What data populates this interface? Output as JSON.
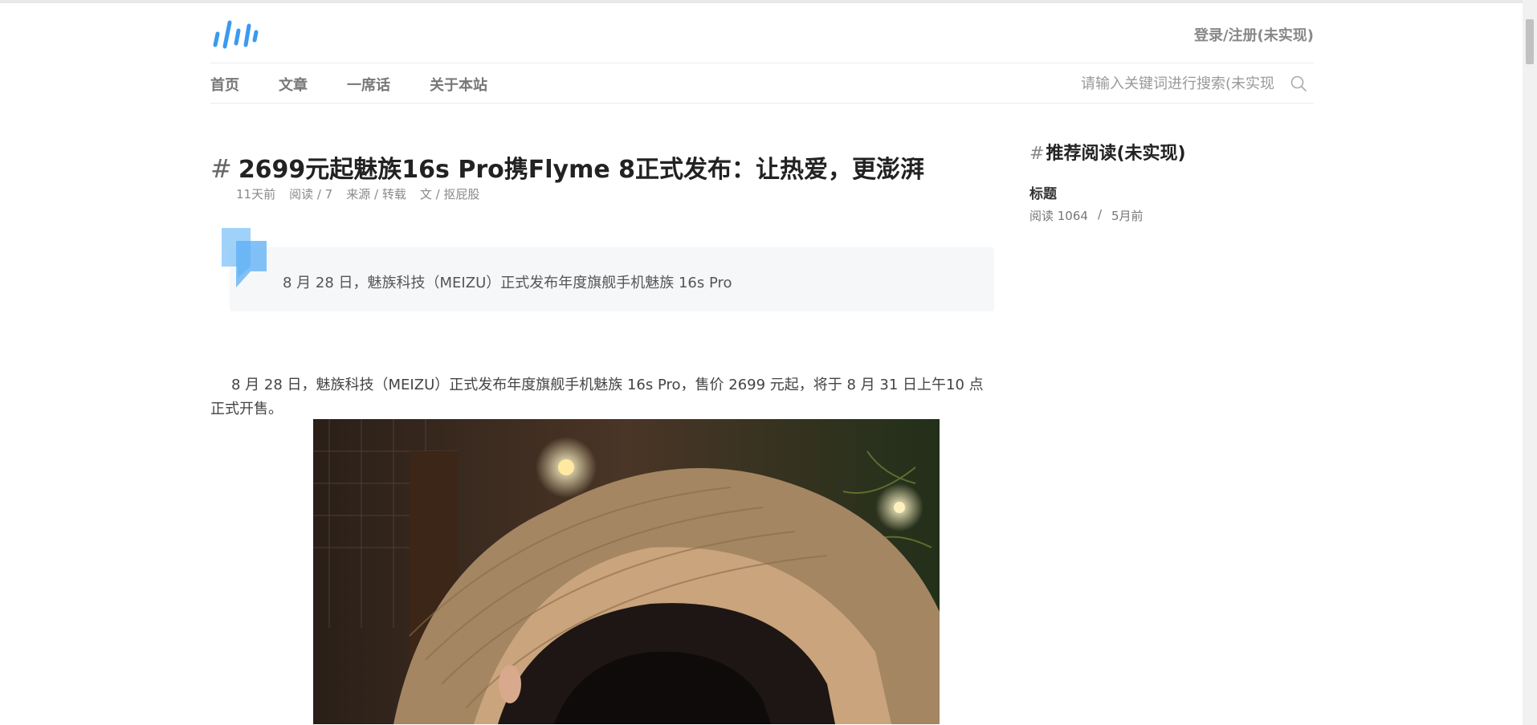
{
  "header": {
    "login_label": "登录/注册(未实现)",
    "logo_icon": "waveform-logo-icon",
    "brand_color": "#3a9af0"
  },
  "nav": {
    "items": [
      "首页",
      "文章",
      "一席话",
      "关于本站"
    ]
  },
  "search": {
    "placeholder": "请输入关键词进行搜索(未实现",
    "icon": "search-icon"
  },
  "article": {
    "title": "2699元起魅族16s Pro携Flyme 8正式发布：让热爱，更澎湃",
    "title_hash": "#",
    "meta": {
      "time": "11天前",
      "reads": "阅读 / 7",
      "source": "来源 / 转载",
      "author": "文 / 抠屁股"
    },
    "summary": "8 月 28 日，魅族科技（MEIZU）正式发布年度旗舰手机魅族 16s Pro",
    "paragraph": "8 月 28 日，魅族科技（MEIZU）正式发布年度旗舰手机魅族 16s Pro，售价 2699 元起，将于 8 月 31 日上午10 点正式开售。"
  },
  "sidebar": {
    "hash": "#",
    "title": "推荐阅读(未实现)",
    "items": [
      {
        "title": "标题",
        "reads": "阅读 1064",
        "sep": "/",
        "time": "5月前"
      }
    ]
  }
}
